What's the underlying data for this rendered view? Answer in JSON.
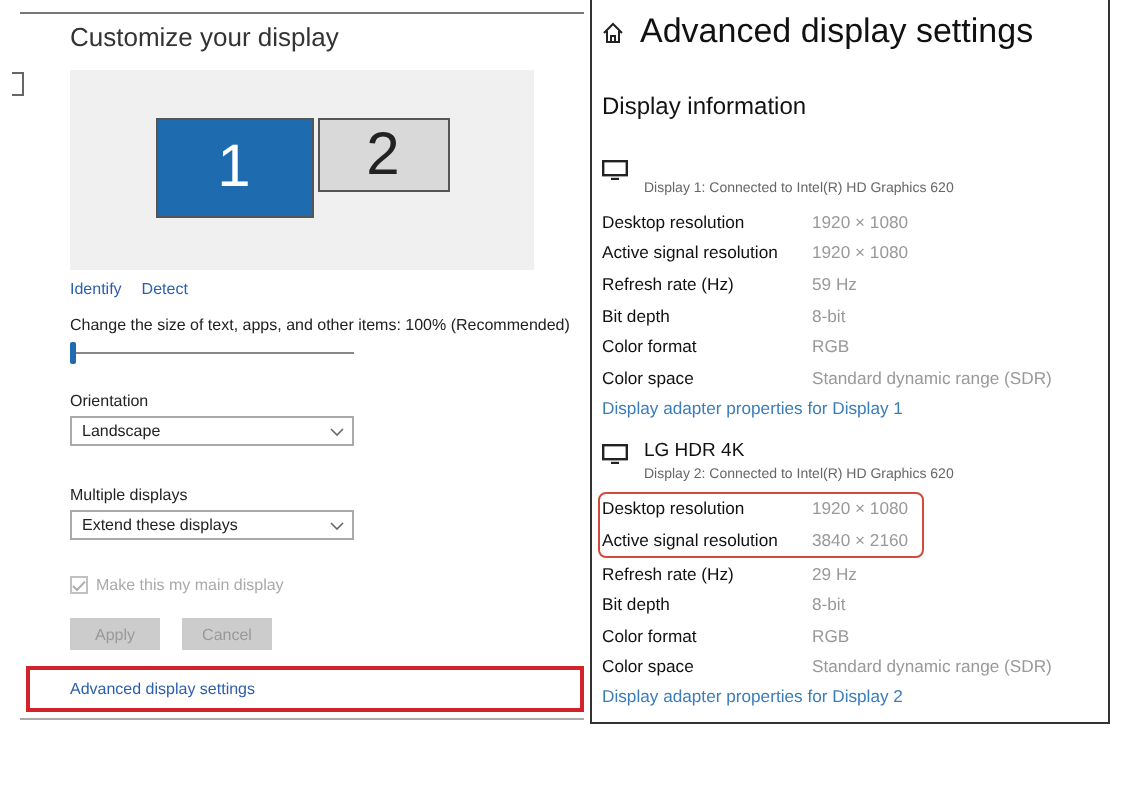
{
  "display_settings": {
    "title": "Customize your display",
    "monitors": [
      {
        "label": "1",
        "selected": true
      },
      {
        "label": "2",
        "selected": false
      }
    ],
    "links": [
      "Identify",
      "Detect"
    ],
    "scale": {
      "label": "Change the size of text, apps, and other items: 100% (Recommended)",
      "level": 0.0
    },
    "orientation": {
      "label": "Orientation",
      "value": "Landscape"
    },
    "multiple_displays": {
      "label": "Multiple displays",
      "value": "Extend these displays"
    },
    "main_display": {
      "label": "Make this my main display",
      "checked": true,
      "disabled": true
    },
    "buttons": [
      {
        "label": "Apply",
        "disabled": true
      },
      {
        "label": "Cancel",
        "disabled": true
      }
    ],
    "advanced_link": {
      "label": "Advanced display settings",
      "highlighted": true
    }
  },
  "advanced": {
    "title": "Advanced display settings",
    "section": "Display information",
    "displays": [
      {
        "connection": "Display 1: Connected to Intel(R) HD Graphics 620",
        "rows": [
          {
            "label": "Desktop resolution",
            "value": "1920 × 1080",
            "highlighted": false
          },
          {
            "label": "Active signal resolution",
            "value": "1920 × 1080",
            "highlighted": false
          },
          {
            "label": "Refresh rate (Hz)",
            "value": "59 Hz",
            "highlighted": false
          },
          {
            "label": "Bit depth",
            "value": "8-bit",
            "highlighted": false
          },
          {
            "label": "Color format",
            "value": "RGB",
            "highlighted": false
          },
          {
            "label": "Color space",
            "value": "Standard dynamic range (SDR)",
            "highlighted": false
          }
        ],
        "adapter_link": "Display adapter properties for Display 1"
      },
      {
        "name": "LG HDR 4K",
        "connection": "Display 2: Connected to Intel(R) HD Graphics 620",
        "rows": [
          {
            "label": "Desktop resolution",
            "value": "1920 × 1080",
            "highlighted": true
          },
          {
            "label": "Active signal resolution",
            "value": "3840 × 2160",
            "highlighted": true
          },
          {
            "label": "Refresh rate (Hz)",
            "value": "29 Hz",
            "highlighted": false
          },
          {
            "label": "Bit depth",
            "value": "8-bit",
            "highlighted": false
          },
          {
            "label": "Color format",
            "value": "RGB",
            "highlighted": false
          },
          {
            "label": "Color space",
            "value": "Standard dynamic range (SDR)",
            "highlighted": false
          }
        ],
        "adapter_link": "Display adapter properties for Display 2"
      }
    ]
  }
}
